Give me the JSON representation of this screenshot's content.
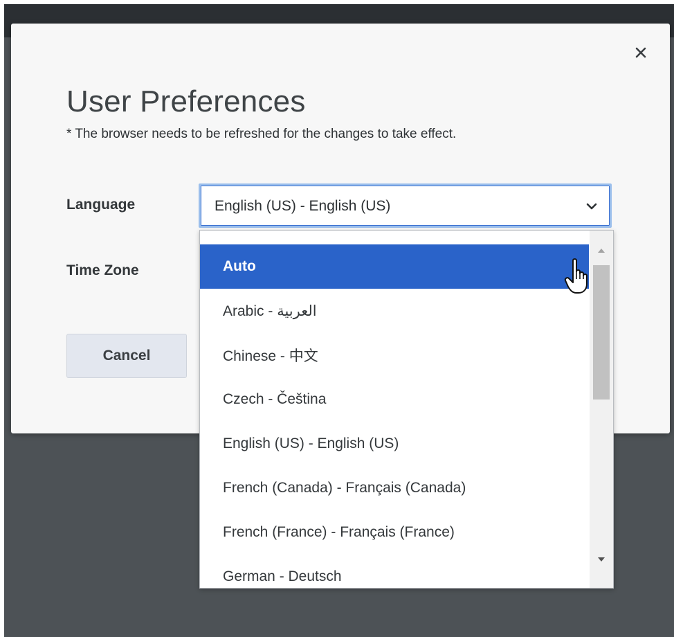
{
  "dialog": {
    "title": "User Preferences",
    "note": "* The browser needs to be refreshed for the changes to take effect.",
    "close_icon": "close-icon"
  },
  "fields": {
    "language_label": "Language",
    "timezone_label": "Time Zone",
    "language_selected": "English (US) - English (US)"
  },
  "buttons": {
    "cancel": "Cancel"
  },
  "dropdown": {
    "options": [
      "Auto",
      "Arabic - العربية",
      "Chinese - 中文",
      "Czech - Čeština",
      "English (US) - English (US)",
      "French (Canada) - Français (Canada)",
      "French (France) - Français (France)",
      "German - Deutsch"
    ],
    "highlighted_index": 0
  },
  "colors": {
    "accent": "#2a63c9",
    "focus_ring": "#9bbfec",
    "backdrop": "#4d5256"
  }
}
